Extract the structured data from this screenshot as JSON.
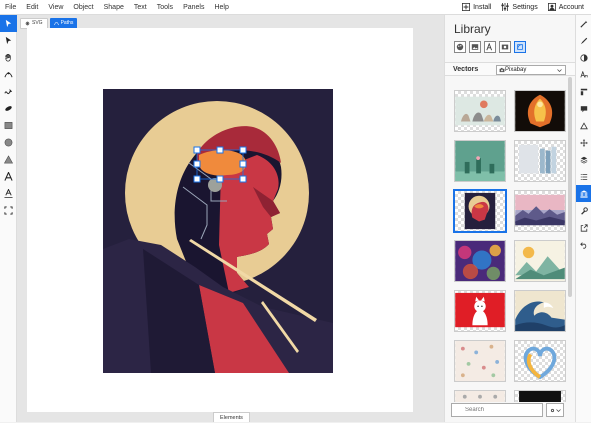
{
  "menu": [
    "File",
    "Edit",
    "View",
    "Object",
    "Shape",
    "Text",
    "Tools",
    "Panels",
    "Help"
  ],
  "menu_right": {
    "install": "Install",
    "settings": "Settings",
    "account": "Account"
  },
  "breadcrumb": {
    "svg": "SVG",
    "paths": "Paths"
  },
  "canvas": {
    "elements_tab": "Elements"
  },
  "library": {
    "title": "Library",
    "section_label": "Vectors",
    "source": "Pixabay",
    "search_placeholder": "Search"
  },
  "colors": {
    "accent": "#1a73e8",
    "sun": "#e8cc94",
    "night": "#25203d",
    "red": "#c93745"
  }
}
